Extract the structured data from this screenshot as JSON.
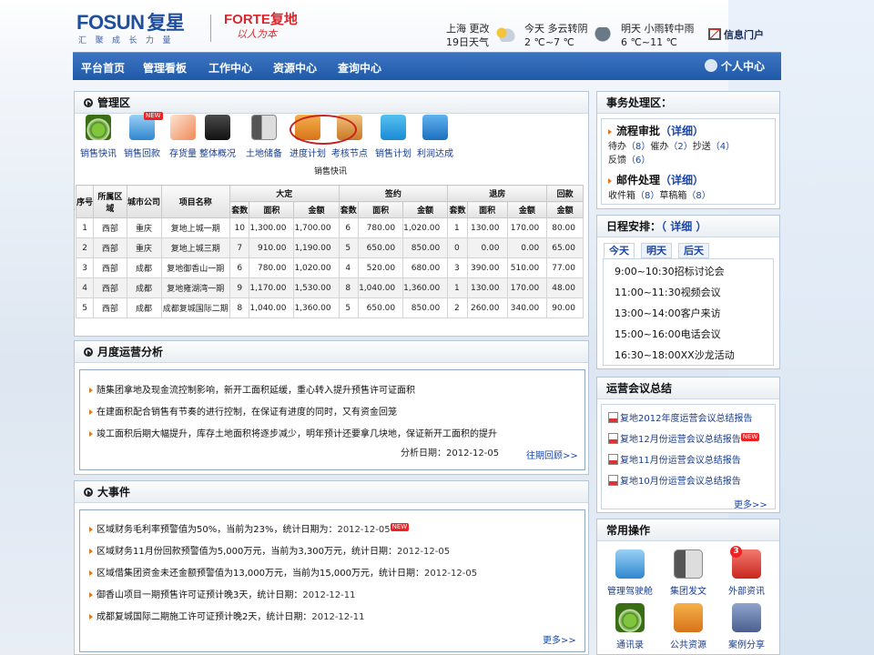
{
  "header": {
    "logo_en": "FOSUN",
    "logo_cn": "复星",
    "slogan": "汇聚成长力量",
    "forte": "FORTE复地",
    "forte_sub": "以人为本",
    "weather": {
      "city": "上海",
      "change_link": "更改",
      "day_label": "19日天气",
      "today_cond": "今天 多云转阴",
      "today_temp": "2 ℃~7 ℃",
      "tomorrow_cond": "明天 小雨转中雨",
      "tomorrow_temp": "6 ℃~11 ℃"
    },
    "portal": "信息门户"
  },
  "nav": {
    "items": [
      "平台首页",
      "管理看板",
      "工作中心",
      "资源中心",
      "查询中心"
    ],
    "user_center": "个人中心"
  },
  "mgmt": {
    "title": "管理区",
    "apps": [
      {
        "label": "销售快讯",
        "icon": "sales-news-icon"
      },
      {
        "label": "销售回款",
        "icon": "sales-payment-icon",
        "new": "NEW"
      },
      {
        "label": "存货量",
        "icon": "inventory-icon"
      },
      {
        "label": "整体概况",
        "icon": "overview-icon"
      },
      {
        "label": "土地储备",
        "icon": "land-reserve-icon"
      },
      {
        "label": "进度计划",
        "icon": "progress-plan-icon"
      },
      {
        "label": "考核节点",
        "icon": "assessment-node-icon"
      },
      {
        "label": "销售计划",
        "icon": "sales-plan-icon"
      },
      {
        "label": "利润达成",
        "icon": "profit-icon"
      }
    ],
    "table": {
      "caption": "销售快讯",
      "group_headers": [
        "大定",
        "签约",
        "退房",
        "回款"
      ],
      "fixed_headers": [
        "序号",
        "所属区域",
        "城市公司",
        "项目名称"
      ],
      "sub_headers": [
        "套数",
        "面积",
        "金额",
        "套数",
        "面积",
        "金额",
        "套数",
        "面积",
        "金额",
        "金额"
      ],
      "rows": [
        [
          "1",
          "西部",
          "重庆",
          "复地上城一期",
          "10",
          "1,300.00",
          "1,700.00",
          "6",
          "780.00",
          "1,020.00",
          "1",
          "130.00",
          "170.00",
          "80.00"
        ],
        [
          "2",
          "西部",
          "重庆",
          "复地上城三期",
          "7",
          "910.00",
          "1,190.00",
          "5",
          "650.00",
          "850.00",
          "0",
          "0.00",
          "0.00",
          "65.00"
        ],
        [
          "3",
          "西部",
          "成都",
          "复地御香山一期",
          "6",
          "780.00",
          "1,020.00",
          "4",
          "520.00",
          "680.00",
          "3",
          "390.00",
          "510.00",
          "77.00"
        ],
        [
          "4",
          "西部",
          "成都",
          "复地雍湖湾一期",
          "9",
          "1,170.00",
          "1,530.00",
          "8",
          "1,040.00",
          "1,360.00",
          "1",
          "130.00",
          "170.00",
          "48.00"
        ],
        [
          "5",
          "西部",
          "成都",
          "成都复城国际二期",
          "8",
          "1,040.00",
          "1,360.00",
          "5",
          "650.00",
          "850.00",
          "2",
          "260.00",
          "340.00",
          "90.00"
        ]
      ]
    }
  },
  "monthly": {
    "title": "月度运营分析",
    "lines": [
      "随集团拿地及现金流控制影响，新开工面积延缓，重心转入提升预售许可证面积",
      "在建面积配合销售有节奏的进行控制，在保证有进度的同时，又有资金回笼",
      "竣工面积后期大幅提升，库存土地面积将逐步减少，明年预计还要拿几块地，保证新开工面积的提升"
    ],
    "date": "分析日期：2012-12-05",
    "more": "往期回顾>>"
  },
  "events": {
    "title": "大事件",
    "items": [
      {
        "text": "区域财务毛利率预警值为50%，当前为23%，统计日期为：",
        "date": "2012-12-05",
        "new": "NEW"
      },
      {
        "text": "区域财务11月份回款预警值为5,000万元，当前为3,300万元，统计日期：",
        "date": "2012-12-05"
      },
      {
        "text": "区域借集团资金未还金额预警值为13,000万元，当前为15,000万元，统计日期：",
        "date": "2012-12-05"
      },
      {
        "text": "御香山项目一期预售许可证预计晚3天，统计日期：",
        "date": "2012-12-11"
      },
      {
        "text": "成都复城国际二期施工许可证预计晚2天，统计日期：",
        "date": "2012-12-11"
      }
    ],
    "more": "更多>>"
  },
  "affairs": {
    "title": "事务处理区：",
    "flow_title": "流程审批",
    "flow_detail": "（详细）",
    "pending": "待办",
    "pending_count": "（8）",
    "done": "催办",
    "done_count": "（2）",
    "cc": "抄送",
    "cc_count": "（4）",
    "feedback": "反馈",
    "feedback_count": "（6）",
    "mail_title": "邮件处理",
    "mail_detail": "（详细）",
    "inbox": "收件箱",
    "inbox_count": "（8）",
    "draft": "草稿箱",
    "draft_count": "（8）"
  },
  "schedule": {
    "title": "日程安排：",
    "detail": "（ 详细 ）",
    "tabs": [
      "今天",
      "明天",
      "后天"
    ],
    "items": [
      "9:00~10:30招标讨论会",
      "11:00~11:30视频会议",
      "13:00~14:00客户来访",
      "15:00~16:00电话会议",
      "16:30~18:00XX沙龙活动"
    ]
  },
  "meetings": {
    "title": "运营会议总结",
    "items": [
      {
        "text": "复地2012年度运营会议总结报告"
      },
      {
        "text": "复地12月份运营会议总结报告",
        "new": "NEW"
      },
      {
        "text": "复地11月份运营会议总结报告"
      },
      {
        "text": "复地10月份运营会议总结报告"
      }
    ],
    "more": "更多>>"
  },
  "common": {
    "title": "常用操作",
    "items": [
      {
        "label": "管理驾驶舱",
        "icon": "cockpit-icon"
      },
      {
        "label": "集团发文",
        "icon": "group-docs-icon"
      },
      {
        "label": "外部资讯",
        "icon": "external-news-icon",
        "badge": "3"
      },
      {
        "label": "通讯录",
        "icon": "address-book-icon"
      },
      {
        "label": "公共资源",
        "icon": "public-resource-icon"
      },
      {
        "label": "案例分享",
        "icon": "case-share-icon"
      }
    ]
  }
}
